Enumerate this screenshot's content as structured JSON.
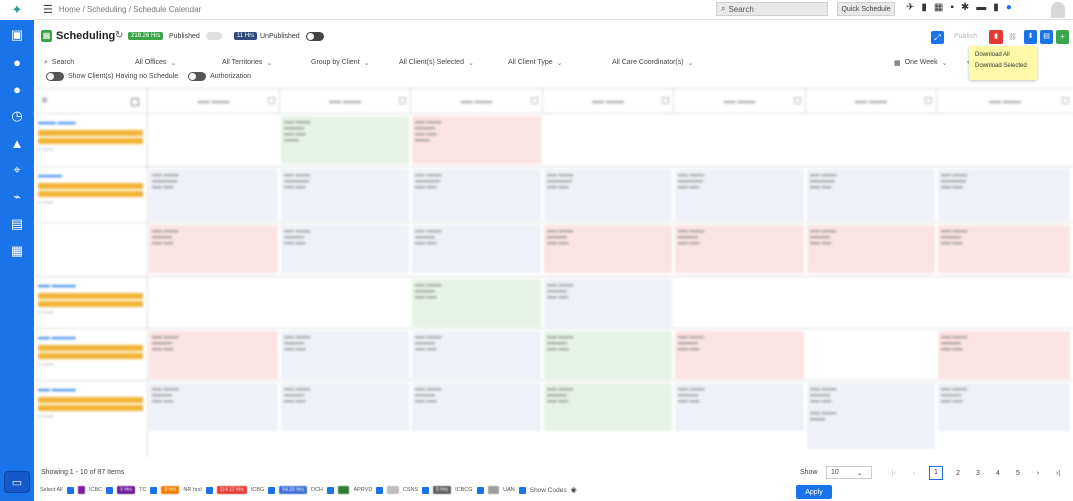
{
  "topbar": {
    "breadcrumb": "Home / Scheduling / Schedule Calendar",
    "search_placeholder": "Search",
    "quick_schedule": "Quick Schedule"
  },
  "title": {
    "text": "Scheduling",
    "published_hrs": "218.26 Hrs",
    "published_label": "Published",
    "unpublished_hrs": "11 Hrs",
    "unpublished_label": "UnPublished",
    "publish_button": "Publish"
  },
  "download_menu": [
    "Download All",
    "Download Selected"
  ],
  "filters": {
    "search": "Search",
    "offices": "All Offices",
    "territories": "All Territories",
    "group": "Group by Client",
    "clients": "All Client(s) Selected",
    "client_type": "All Client Type",
    "coordinators": "All Care Coordinator(s)",
    "view": "One Week"
  },
  "toggles": {
    "no_schedule": "Show Client(s) Having no Schedule",
    "authorization": "Authorization"
  },
  "footer": {
    "showing": "Showing 1 - 10 of 87 Items",
    "show_label": "Show",
    "page_size": "10",
    "pages": [
      "1",
      "2",
      "3",
      "4",
      "5"
    ],
    "current_page": "1",
    "select_all": "Select All",
    "show_codes": "Show Codes",
    "apply": "Apply"
  },
  "legend": [
    {
      "hrs": "",
      "code": "ICBC",
      "color": "#7b1fa2"
    },
    {
      "hrs": "0 Hrs",
      "code": "TC",
      "color": "#6a1b9a"
    },
    {
      "hrs": "0 Hrs",
      "code": "NR hrsl",
      "color": "#f57c00"
    },
    {
      "hrs": "114.12 Hrs",
      "code": "ICBG",
      "color": "#e53935"
    },
    {
      "hrs": "64.33 Hrs",
      "code": "DCH",
      "color": "#3f6fd8"
    },
    {
      "hrs": "",
      "code": "APRVD",
      "color": "#2e7d32"
    },
    {
      "hrs": "",
      "code": "CSNS",
      "color": "#bdbdbd"
    },
    {
      "hrs": "0 Hrs",
      "code": "ICBCG",
      "color": "#616161"
    },
    {
      "hrs": "",
      "code": "UAN",
      "color": "#9e9e9e"
    }
  ],
  "icons": {
    "menu": "menu-icon",
    "search": "search-icon",
    "help": "help-icon",
    "download": "download-icon",
    "share": "share-icon"
  }
}
